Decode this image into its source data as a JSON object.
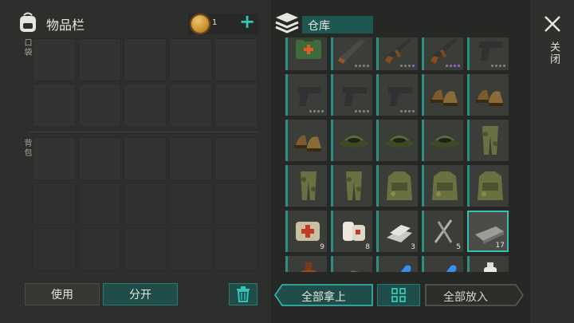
{
  "inventory": {
    "title": "物品栏",
    "coins": "1",
    "pocket_label": "口袋",
    "backpack_label": "背包"
  },
  "storage": {
    "title": "仓库"
  },
  "buttons": {
    "use": "使用",
    "split": "分开",
    "take_all": "全部拿上",
    "put_all": "全部放入",
    "close": "关闭"
  },
  "icons": {
    "bag": "backpack-icon",
    "coin": "coin-icon",
    "plus": "plus-icon",
    "storage": "stack-icon",
    "trash": "trash-icon",
    "grid": "grid-icon",
    "close": "close-icon"
  },
  "colors": {
    "accent": "#33c6b8",
    "teal_button": "#1f4d49",
    "rarity_purple": "#9b5cd6"
  },
  "storage_items": [
    {
      "name": "green-medkit"
    },
    {
      "name": "shotgun"
    },
    {
      "name": "assault-rifle"
    },
    {
      "name": "assault-rifle"
    },
    {
      "name": "pistol"
    },
    {
      "name": "pistol"
    },
    {
      "name": "pistol"
    },
    {
      "name": "pistol"
    },
    {
      "name": "leather-boots"
    },
    {
      "name": "leather-boots"
    },
    {
      "name": "leather-boots"
    },
    {
      "name": "camo-cap"
    },
    {
      "name": "camo-cap"
    },
    {
      "name": "camo-cap"
    },
    {
      "name": "camo-pants"
    },
    {
      "name": "camo-pants"
    },
    {
      "name": "camo-pants"
    },
    {
      "name": "camo-vest"
    },
    {
      "name": "camo-vest"
    },
    {
      "name": "camo-vest"
    },
    {
      "name": "first-aid-bag",
      "qty": "9"
    },
    {
      "name": "bandage",
      "qty": "8"
    },
    {
      "name": "scrap-metal",
      "qty": "3"
    },
    {
      "name": "nails",
      "qty": "5"
    },
    {
      "name": "iron-bar",
      "qty": "17"
    },
    {
      "name": "bottle"
    },
    {
      "name": "cloth"
    },
    {
      "name": "blue-crystal"
    },
    {
      "name": "blue-crystal"
    },
    {
      "name": "spray-can"
    }
  ]
}
